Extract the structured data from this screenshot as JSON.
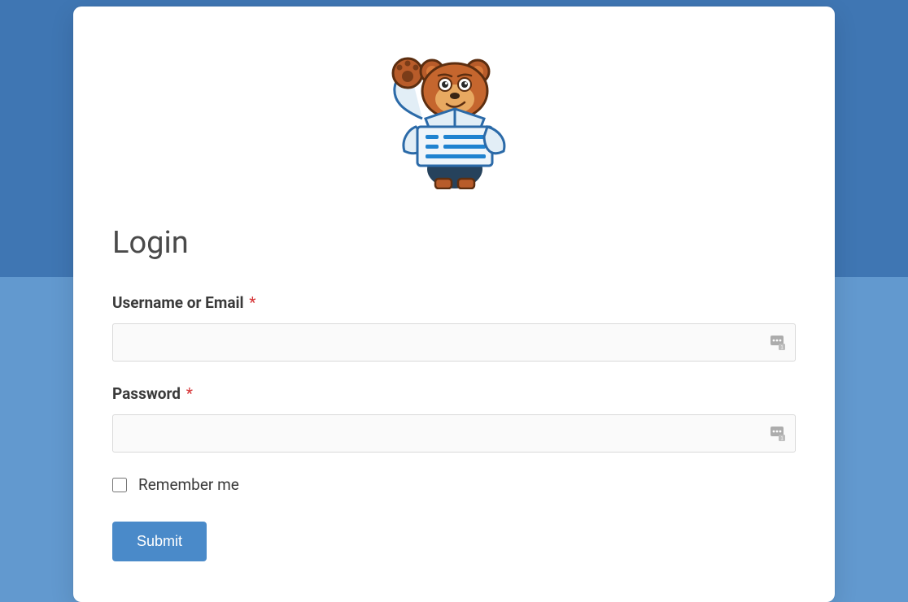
{
  "form": {
    "title": "Login",
    "username": {
      "label": "Username or Email",
      "required": "*",
      "value": ""
    },
    "password": {
      "label": "Password",
      "required": "*",
      "value": ""
    },
    "remember": {
      "label": "Remember me",
      "checked": false
    },
    "submit": {
      "label": "Submit"
    }
  },
  "logo": {
    "alt": "wpforms-mascot"
  }
}
